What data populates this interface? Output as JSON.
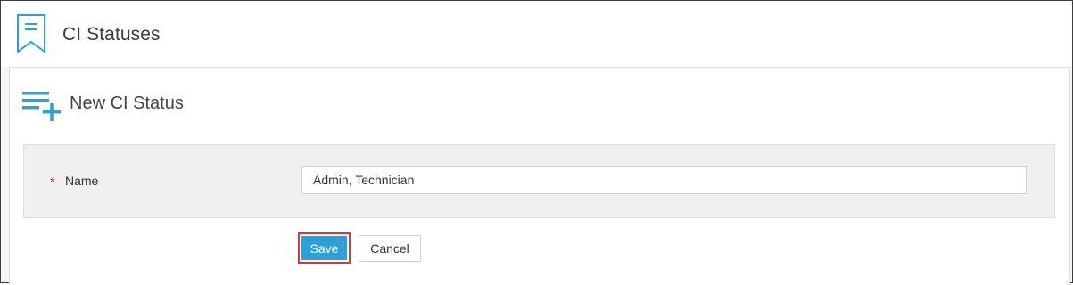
{
  "header": {
    "title": "CI Statuses",
    "icon": "bookmark-icon"
  },
  "panel": {
    "title": "New CI Status",
    "icon": "add-list-icon",
    "accent_color": "#2f9fd8"
  },
  "form": {
    "required_marker": "*",
    "name_label": "Name",
    "name_value": "Admin, Technician",
    "name_placeholder": ""
  },
  "actions": {
    "save_label": "Save",
    "cancel_label": "Cancel",
    "save_color": "#2f9fd8",
    "highlight_color": "#d9383a"
  }
}
